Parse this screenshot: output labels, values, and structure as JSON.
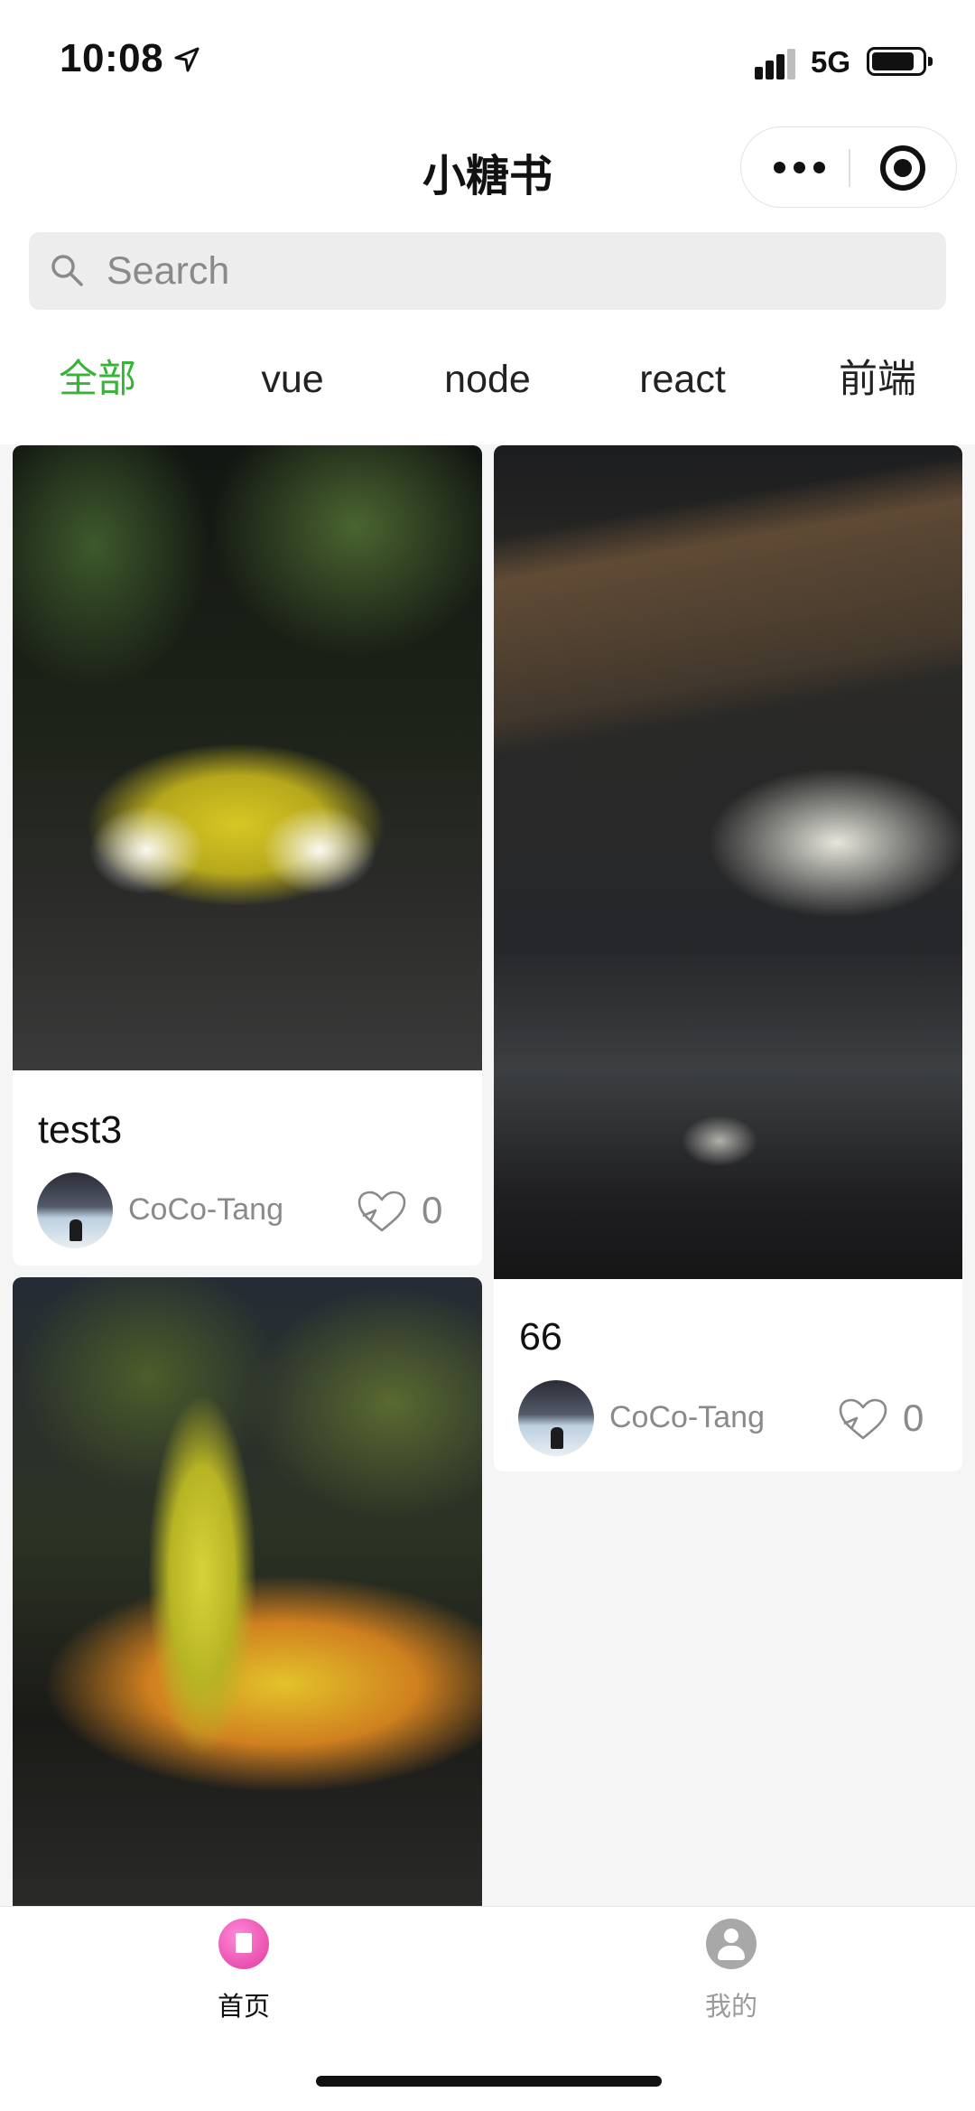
{
  "status_bar": {
    "time": "10:08",
    "network": "5G"
  },
  "nav": {
    "title": "小糖书"
  },
  "search": {
    "placeholder": "Search"
  },
  "tabs": [
    "全部",
    "vue",
    "node",
    "react",
    "前端"
  ],
  "active_tab": "全部",
  "colors": {
    "accent": "#37b437",
    "home_icon": "#e0389f"
  },
  "posts": [
    {
      "title": "test3",
      "author": "CoCo-Tang",
      "likes": "0",
      "image_desc": "yellow sports car at night"
    },
    {
      "title": "66",
      "author": "CoCo-Tang",
      "likes": "0",
      "image_desc": "building entrance at night"
    },
    {
      "title": "",
      "author": "",
      "likes": "",
      "image_desc": "yellow sports car with open door"
    }
  ],
  "tabbar": {
    "home": "首页",
    "me": "我的"
  }
}
